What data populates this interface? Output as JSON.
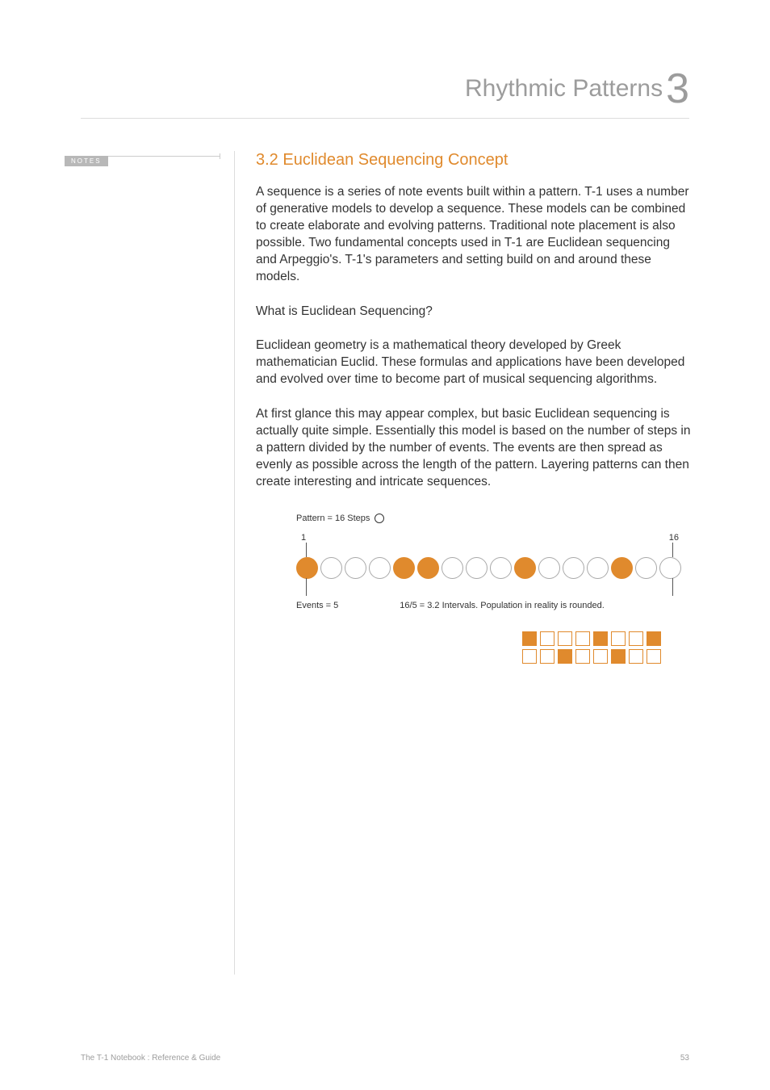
{
  "chapter": {
    "title": "Rhythmic Patterns",
    "number": "3"
  },
  "notes": {
    "tab": "NOTES"
  },
  "section": {
    "title": "3.2 Euclidean Sequencing Concept"
  },
  "body": {
    "p1": "A sequence is a series of note events built within a pattern. T-1 uses a number of generative models to develop a sequence. These models can be combined to create elaborate and evolving patterns. Traditional note placement is also possible. Two fundamental concepts used in T-1 are Euclidean sequencing and Arpeggio's. T-1's parameters and setting build on and around these models.",
    "q": "What is Euclidean Sequencing?",
    "p2": "Euclidean geometry is a mathematical theory developed by Greek mathematician Euclid. These formulas and applications have been developed and evolved over time to become part of musical sequencing algorithms.",
    "p3": "At first glance this may appear complex, but basic Euclidean sequencing is actually quite simple. Essentially this model is based on the number of steps in a pattern divided by the number of events. The events are then spread as evenly as possible across the length of the pattern. Layering patterns can then create interesting and intricate sequences."
  },
  "figure": {
    "pattern_label": "Pattern = 16 Steps",
    "axis_start": "1",
    "axis_end": "16",
    "events_label": "Events = 5",
    "interval_text": "16/5 = 3.2 Intervals. Population in reality is rounded."
  },
  "chart_data": {
    "type": "table",
    "title": "Euclidean distribution of 5 events across 16 steps",
    "steps": 16,
    "events": 5,
    "circle_pattern": [
      1,
      0,
      0,
      0,
      1,
      1,
      0,
      0,
      0,
      1,
      0,
      0,
      0,
      1,
      0,
      0
    ],
    "grid_row_top": [
      1,
      0,
      0,
      0,
      1,
      0,
      0,
      1
    ],
    "grid_row_bottom": [
      0,
      0,
      1,
      0,
      0,
      1,
      0,
      0
    ]
  },
  "footer": {
    "left": "The T-1 Notebook : Reference & Guide",
    "page": "53"
  }
}
